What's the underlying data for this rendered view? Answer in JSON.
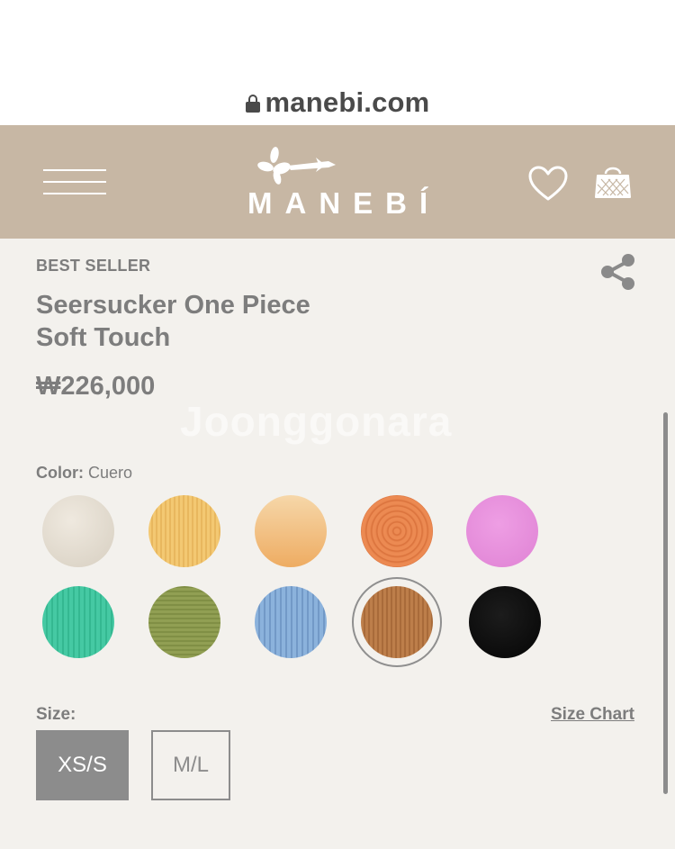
{
  "browser": {
    "url": "manebi.com",
    "icons": {
      "lock": "lock-icon"
    }
  },
  "header": {
    "brand": "MANEBÍ",
    "background_color": "#c7b7a4",
    "icons": {
      "menu": "hamburger-menu-icon",
      "logo": "manebi-flower-logo",
      "wishlist": "heart-icon",
      "bag": "shopping-bag-icon"
    }
  },
  "product": {
    "badge": "BEST SELLER",
    "title_line1": "Seersucker One Piece",
    "title_line2": "Soft Touch",
    "price": "₩226,000",
    "share_icon": "share-icon"
  },
  "watermark": "Joonggonara",
  "color": {
    "label": "Color:",
    "selected": "Cuero",
    "swatch_colors": [
      "#e4ddd1",
      "#f1c56e",
      "#f0b878",
      "#e9834b",
      "#e790db",
      "#3fc6a0",
      "#8d9b4f",
      "#86add8",
      "#b97a46",
      "#111111"
    ]
  },
  "size": {
    "label": "Size:",
    "chart_link": "Size Chart",
    "options": [
      "XS/S",
      "M/L"
    ],
    "selected": "XS/S"
  }
}
